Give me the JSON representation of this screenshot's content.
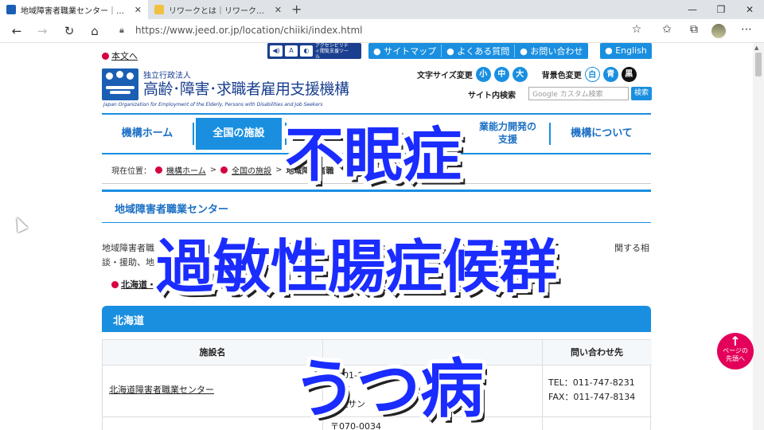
{
  "browser": {
    "tabs": [
      {
        "title": "地域障害者職業センター｜独立行政",
        "favicon_color": "#1a5fb4",
        "active": true
      },
      {
        "title": "リワークとは｜リワークの内容と利用の",
        "favicon_color": "#e0a000",
        "active": false
      }
    ],
    "url": "https://www.jeed.or.jp/location/chiiki/index.html"
  },
  "header": {
    "skip_link": "本文へ",
    "accessibility_label": "アクセシビリティ閲覧支援ツール",
    "top_nav": [
      "サイトマップ",
      "よくある質問",
      "お問い合わせ"
    ],
    "english": "English",
    "org_small": "独立行政法人",
    "org_name": "高齢･障害･求職者雇用支援機構",
    "org_en": "Japan Organization for Employment of the Elderly, Persons with Disabilities and Job Seekers",
    "font_size_label": "文字サイズ変更",
    "font_sizes": [
      "小",
      "中",
      "大"
    ],
    "bg_color_label": "背景色変更",
    "bg_colors": [
      "白",
      "青",
      "黒"
    ],
    "search_label": "サイト内検索",
    "search_placeholder": "Google カスタム検索",
    "search_button": "検索"
  },
  "main_nav": [
    "機構ホーム",
    "全国の施設",
    "業能力開発の支援",
    "機構について"
  ],
  "breadcrumb": {
    "prefix": "現在位置：",
    "items": [
      "機構ホーム",
      "全国の施設",
      "地域障害者職"
    ]
  },
  "page_title": "地域障害者職業センター",
  "lead": {
    "line1": "地域障害者職",
    "line1_end": "関する相",
    "line2": "談・援助、地"
  },
  "anchor_link": "北海道・",
  "region": "北海道",
  "table": {
    "headers": [
      "施設名",
      "問い合わせ先"
    ],
    "rows": [
      {
        "name": "北海道障害者職業センター",
        "address_line1": "01-0024",
        "address_line2": "道",
        "address_line3": "札幌サン",
        "address_line4": "5階",
        "tel": "TEL：011-747-8231",
        "fax": "FAX：011-747-8134"
      }
    ],
    "next_postal": "〒070-0034"
  },
  "overlays": [
    "不眠症",
    "過敏性腸症候群",
    "うつ病"
  ],
  "page_top": "ページの先頭へ"
}
